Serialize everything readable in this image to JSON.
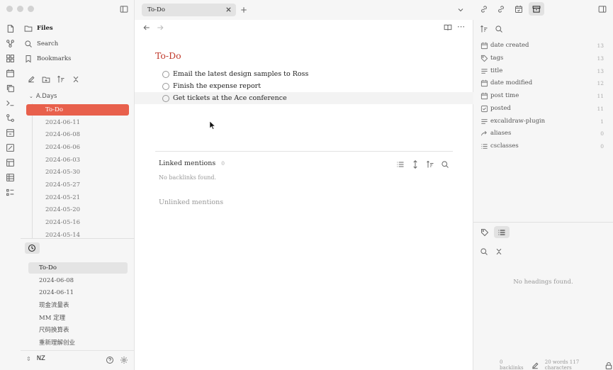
{
  "left_sidebar": {
    "nav": [
      {
        "label": "Files",
        "icon": "folder-icon"
      },
      {
        "label": "Search",
        "icon": "search-icon"
      },
      {
        "label": "Bookmarks",
        "icon": "bookmark-icon"
      }
    ],
    "folder": "A.Days",
    "tree_items": [
      "To-Do",
      "2024-06-11",
      "2024-06-08",
      "2024-06-06",
      "2024-06-03",
      "2024-05-30",
      "2024-05-27",
      "2024-05-21",
      "2024-05-20",
      "2024-05-16",
      "2024-05-14"
    ],
    "recent_items": [
      "To-Do",
      "2024-06-08",
      "2024-06-11",
      "现金流量表",
      "MM 定理",
      "尺码换算表",
      "重新理解创业"
    ],
    "vault_name": "NZ"
  },
  "tab": {
    "title": "To-Do"
  },
  "note": {
    "title": "To-Do",
    "tasks": [
      "Email the latest design samples to Ross",
      "Finish the expense report",
      "Get tickets at the Ace conference"
    ]
  },
  "backlinks": {
    "linked_title": "Linked mentions",
    "linked_count": "0",
    "no_backlinks": "No backlinks found.",
    "unlinked_title": "Unlinked mentions"
  },
  "properties": [
    {
      "name": "date created",
      "count": "13",
      "icon": "calendar-icon"
    },
    {
      "name": "tags",
      "count": "13",
      "icon": "tag-icon"
    },
    {
      "name": "title",
      "count": "13",
      "icon": "text-icon"
    },
    {
      "name": "date modified",
      "count": "12",
      "icon": "calendar-icon"
    },
    {
      "name": "post time",
      "count": "11",
      "icon": "calendar-icon"
    },
    {
      "name": "posted",
      "count": "11",
      "icon": "checkbox-icon"
    },
    {
      "name": "excalidraw-plugin",
      "count": "1",
      "icon": "text-icon"
    },
    {
      "name": "aliases",
      "count": "0",
      "icon": "forward-icon"
    },
    {
      "name": "csclasses",
      "count": "0",
      "icon": "list-icon"
    }
  ],
  "outline": {
    "empty": "No headings found."
  },
  "status": {
    "backlinks": "0 backlinks",
    "words": "20 words",
    "chars": "117 characters"
  }
}
